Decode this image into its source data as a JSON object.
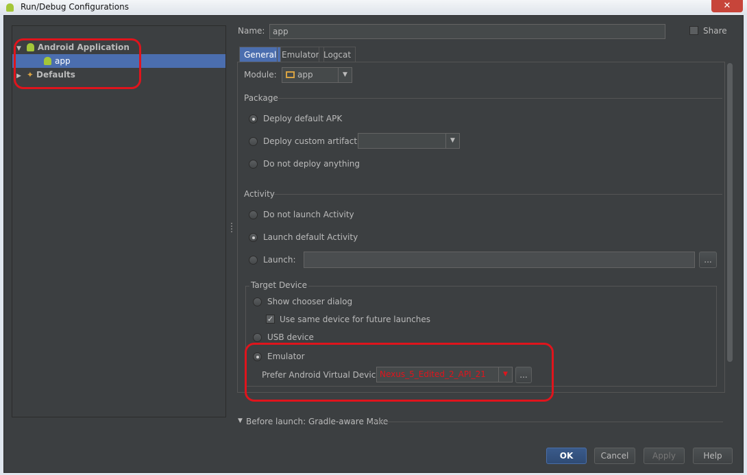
{
  "window": {
    "title": "Run/Debug Configurations",
    "close": "✕"
  },
  "toolbar": {
    "icons": [
      "plus-icon",
      "minus-icon",
      "copy-icon",
      "wrench-icon",
      "arrow-up-icon",
      "arrow-down-icon",
      "folder-icon"
    ],
    "add": "+",
    "remove": "−",
    "up": "↑",
    "down": "↓"
  },
  "tree": {
    "items": [
      {
        "label": "Android Application",
        "expanded": true
      },
      {
        "label": "app",
        "selected": true
      },
      {
        "label": "Defaults",
        "expanded": false
      }
    ]
  },
  "name": {
    "label": "Name:",
    "value": "app"
  },
  "share": {
    "label": "Share",
    "checked": false
  },
  "tabs": [
    {
      "label": "General",
      "active": true
    },
    {
      "label": "Emulator"
    },
    {
      "label": "Logcat"
    }
  ],
  "module": {
    "label": "Module:",
    "value": "app"
  },
  "package": {
    "title": "Package",
    "options": [
      "Deploy default APK",
      "Deploy custom artifact:",
      "Do not deploy anything"
    ],
    "selected": 0
  },
  "activity": {
    "title": "Activity",
    "options": [
      "Do not launch Activity",
      "Launch default Activity",
      "Launch:"
    ],
    "selected": 1,
    "launch_value": "",
    "browse": "..."
  },
  "target": {
    "title": "Target Device",
    "options": [
      "Show chooser dialog",
      "USB device",
      "Emulator"
    ],
    "selected": 2,
    "same_device": "Use same device for future launches",
    "same_device_checked": true,
    "avd_label": "Prefer Android Virtual Device:",
    "avd_value": "Nexus_5_Edited_2_API_21",
    "browse": "...",
    "avd_color": "#e0141c"
  },
  "before_launch": "Before launch: Gradle-aware Make",
  "buttons": {
    "ok": "OK",
    "cancel": "Cancel",
    "apply": "Apply",
    "help": "Help"
  }
}
